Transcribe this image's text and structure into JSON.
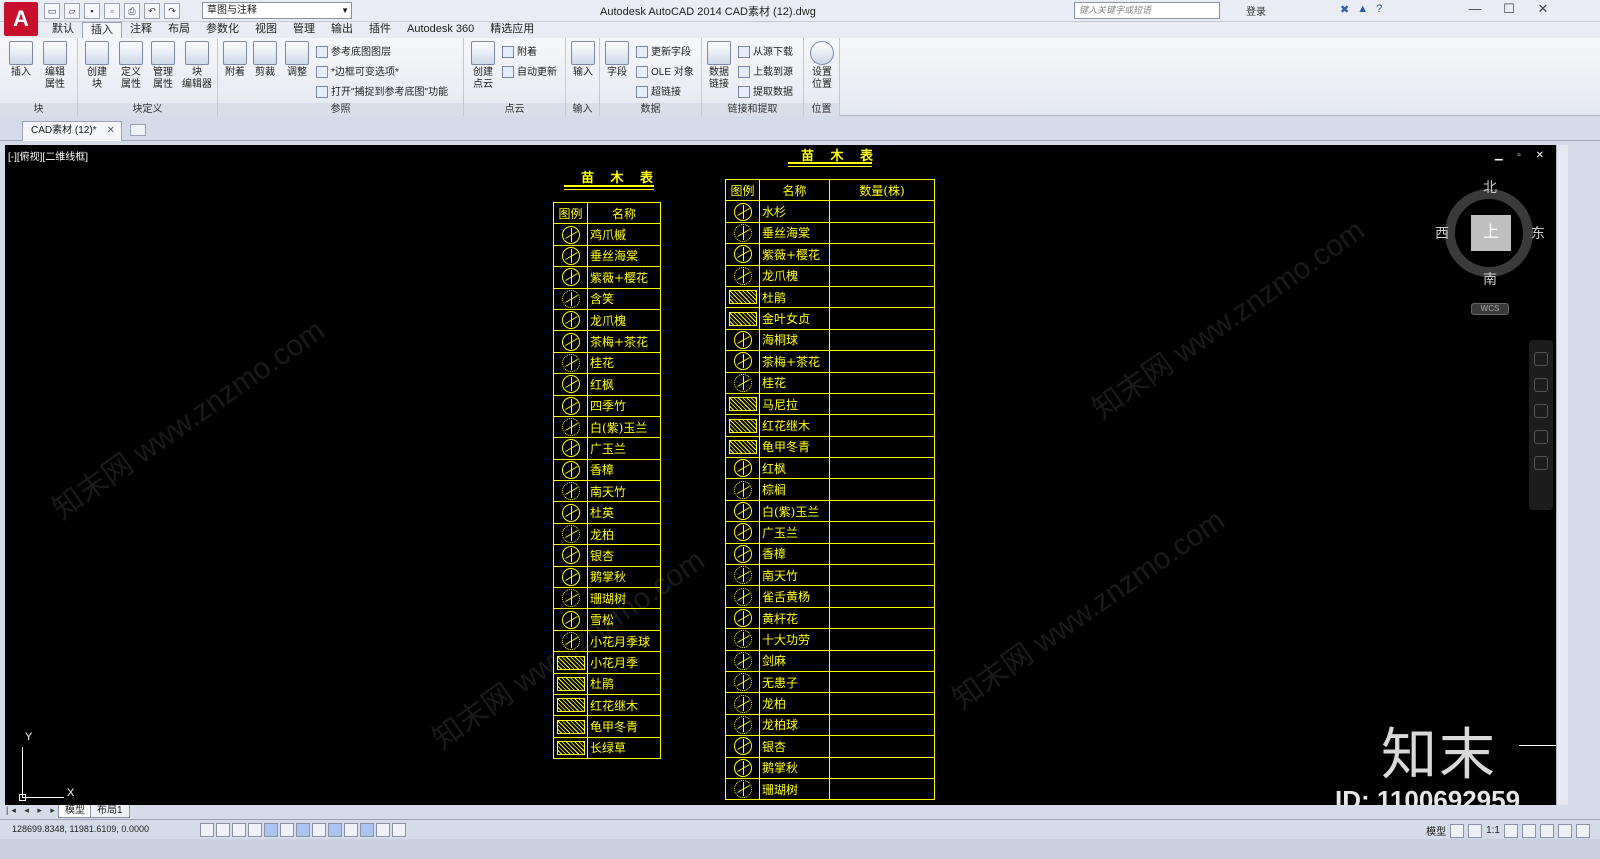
{
  "app": {
    "logo": "A",
    "workspace": "草图与注释",
    "title": "Autodesk AutoCAD 2014      CAD素材 (12).dwg",
    "search_placeholder": "键入关键字或短语",
    "login": "登录"
  },
  "menu_tabs": [
    "默认",
    "插入",
    "注释",
    "布局",
    "参数化",
    "视图",
    "管理",
    "输出",
    "插件",
    "Autodesk 360",
    "精选应用"
  ],
  "active_tab": "插入",
  "ribbon": {
    "block": {
      "title": "块",
      "buttons": [
        "插入",
        "编辑\n属性"
      ]
    },
    "block_def": {
      "title": "块定义",
      "buttons": [
        "创建\n块",
        "定义\n属性",
        "管理\n属性",
        "块\n编辑器"
      ]
    },
    "reference": {
      "title": "参照",
      "buttons": [
        "附着",
        "剪裁",
        "调整"
      ],
      "small": [
        "参考底图图层",
        "*边框可变选项*",
        "打开\"捕捉到参考底图\"功能"
      ]
    },
    "pointcloud": {
      "title": "点云",
      "buttons": [
        "创建\n点云"
      ],
      "small": [
        "附着",
        "自动更新"
      ]
    },
    "import": {
      "title": "输入",
      "buttons": [
        "输入"
      ]
    },
    "data": {
      "title": "数据",
      "buttons": [
        "字段"
      ],
      "small": [
        "更新字段",
        "OLE 对象",
        "超链接"
      ]
    },
    "linking": {
      "title": "链接和提取",
      "buttons": [
        "数据\n链接"
      ],
      "small": [
        "从源下载",
        "上载到源",
        "提取数据"
      ]
    },
    "location": {
      "title": "位置",
      "buttons": [
        "设置\n位置"
      ]
    }
  },
  "file_tab": "CAD素材 (12)*",
  "viewport": {
    "label": "[-][俯视][二维线框]",
    "controls": "▁ ▫ ✕"
  },
  "table1": {
    "title": "苗 木 表",
    "headers": [
      "图例",
      "名称"
    ],
    "rows": [
      {
        "name": "鸡爪槭",
        "icon": "circle"
      },
      {
        "name": "垂丝海棠",
        "icon": "circle"
      },
      {
        "name": "紫薇+樱花",
        "icon": "circle"
      },
      {
        "name": "含笑",
        "icon": "star"
      },
      {
        "name": "龙爪槐",
        "icon": "circle"
      },
      {
        "name": "茶梅+茶花",
        "icon": "circle"
      },
      {
        "name": "桂花",
        "icon": "star"
      },
      {
        "name": "红枫",
        "icon": "circle"
      },
      {
        "name": "四季竹",
        "icon": "circle"
      },
      {
        "name": "白(紫)玉兰",
        "icon": "star"
      },
      {
        "name": "广玉兰",
        "icon": "circle"
      },
      {
        "name": "香樟",
        "icon": "circle"
      },
      {
        "name": "南天竹",
        "icon": "star"
      },
      {
        "name": "杜英",
        "icon": "circle"
      },
      {
        "name": "龙柏",
        "icon": "star"
      },
      {
        "name": "银杏",
        "icon": "circle"
      },
      {
        "name": "鹅掌秋",
        "icon": "circle"
      },
      {
        "name": "珊瑚树",
        "icon": "star"
      },
      {
        "name": "雪松",
        "icon": "circle"
      },
      {
        "name": "小花月季球",
        "icon": "star"
      },
      {
        "name": "小花月季",
        "icon": "hatch"
      },
      {
        "name": "杜鹃",
        "icon": "hatch"
      },
      {
        "name": "红花继木",
        "icon": "hatch"
      },
      {
        "name": "龟甲冬青",
        "icon": "hatch"
      },
      {
        "name": "长绿草",
        "icon": "hatch"
      }
    ]
  },
  "table2": {
    "title": "苗 木 表",
    "headers": [
      "图例",
      "名称",
      "数量(株)"
    ],
    "rows": [
      {
        "name": "水杉",
        "icon": "circle"
      },
      {
        "name": "垂丝海棠",
        "icon": "star"
      },
      {
        "name": "紫薇+樱花",
        "icon": "circle"
      },
      {
        "name": "龙爪槐",
        "icon": "star"
      },
      {
        "name": "杜鹃",
        "icon": "hatch"
      },
      {
        "name": "金叶女贞",
        "icon": "hatch"
      },
      {
        "name": "海桐球",
        "icon": "circle"
      },
      {
        "name": "茶梅+茶花",
        "icon": "circle"
      },
      {
        "name": "桂花",
        "icon": "star"
      },
      {
        "name": "马尼拉",
        "icon": "hatch"
      },
      {
        "name": "红花继木",
        "icon": "hatch"
      },
      {
        "name": "龟甲冬青",
        "icon": "hatch"
      },
      {
        "name": "红枫",
        "icon": "circle"
      },
      {
        "name": "棕榈",
        "icon": "star"
      },
      {
        "name": "白(紫)玉兰",
        "icon": "circle"
      },
      {
        "name": "广玉兰",
        "icon": "circle"
      },
      {
        "name": "香樟",
        "icon": "circle"
      },
      {
        "name": "南天竹",
        "icon": "star"
      },
      {
        "name": "雀舌黄杨",
        "icon": "star"
      },
      {
        "name": "黄杆花",
        "icon": "circle"
      },
      {
        "name": "十大功劳",
        "icon": "star"
      },
      {
        "name": "剑麻",
        "icon": "star"
      },
      {
        "name": "无患子",
        "icon": "star"
      },
      {
        "name": "龙柏",
        "icon": "star"
      },
      {
        "name": "龙柏球",
        "icon": "star"
      },
      {
        "name": "银杏",
        "icon": "circle"
      },
      {
        "name": "鹅掌秋",
        "icon": "circle"
      },
      {
        "name": "珊瑚树",
        "icon": "star"
      }
    ]
  },
  "compass": {
    "north": "北",
    "south": "南",
    "east": "东",
    "west": "西",
    "cube": "上",
    "wcs": "WCS"
  },
  "ucs": {
    "x": "X",
    "y": "Y"
  },
  "watermark": {
    "logo": "知末",
    "id": "ID: 1100692959",
    "site": "知末网 www.znzmo.com"
  },
  "layout_tabs": [
    "模型",
    "布局1"
  ],
  "status": {
    "coords": "128699.8348, 11981.6109, 0.0000",
    "model": "模型",
    "scale": "1:1"
  }
}
